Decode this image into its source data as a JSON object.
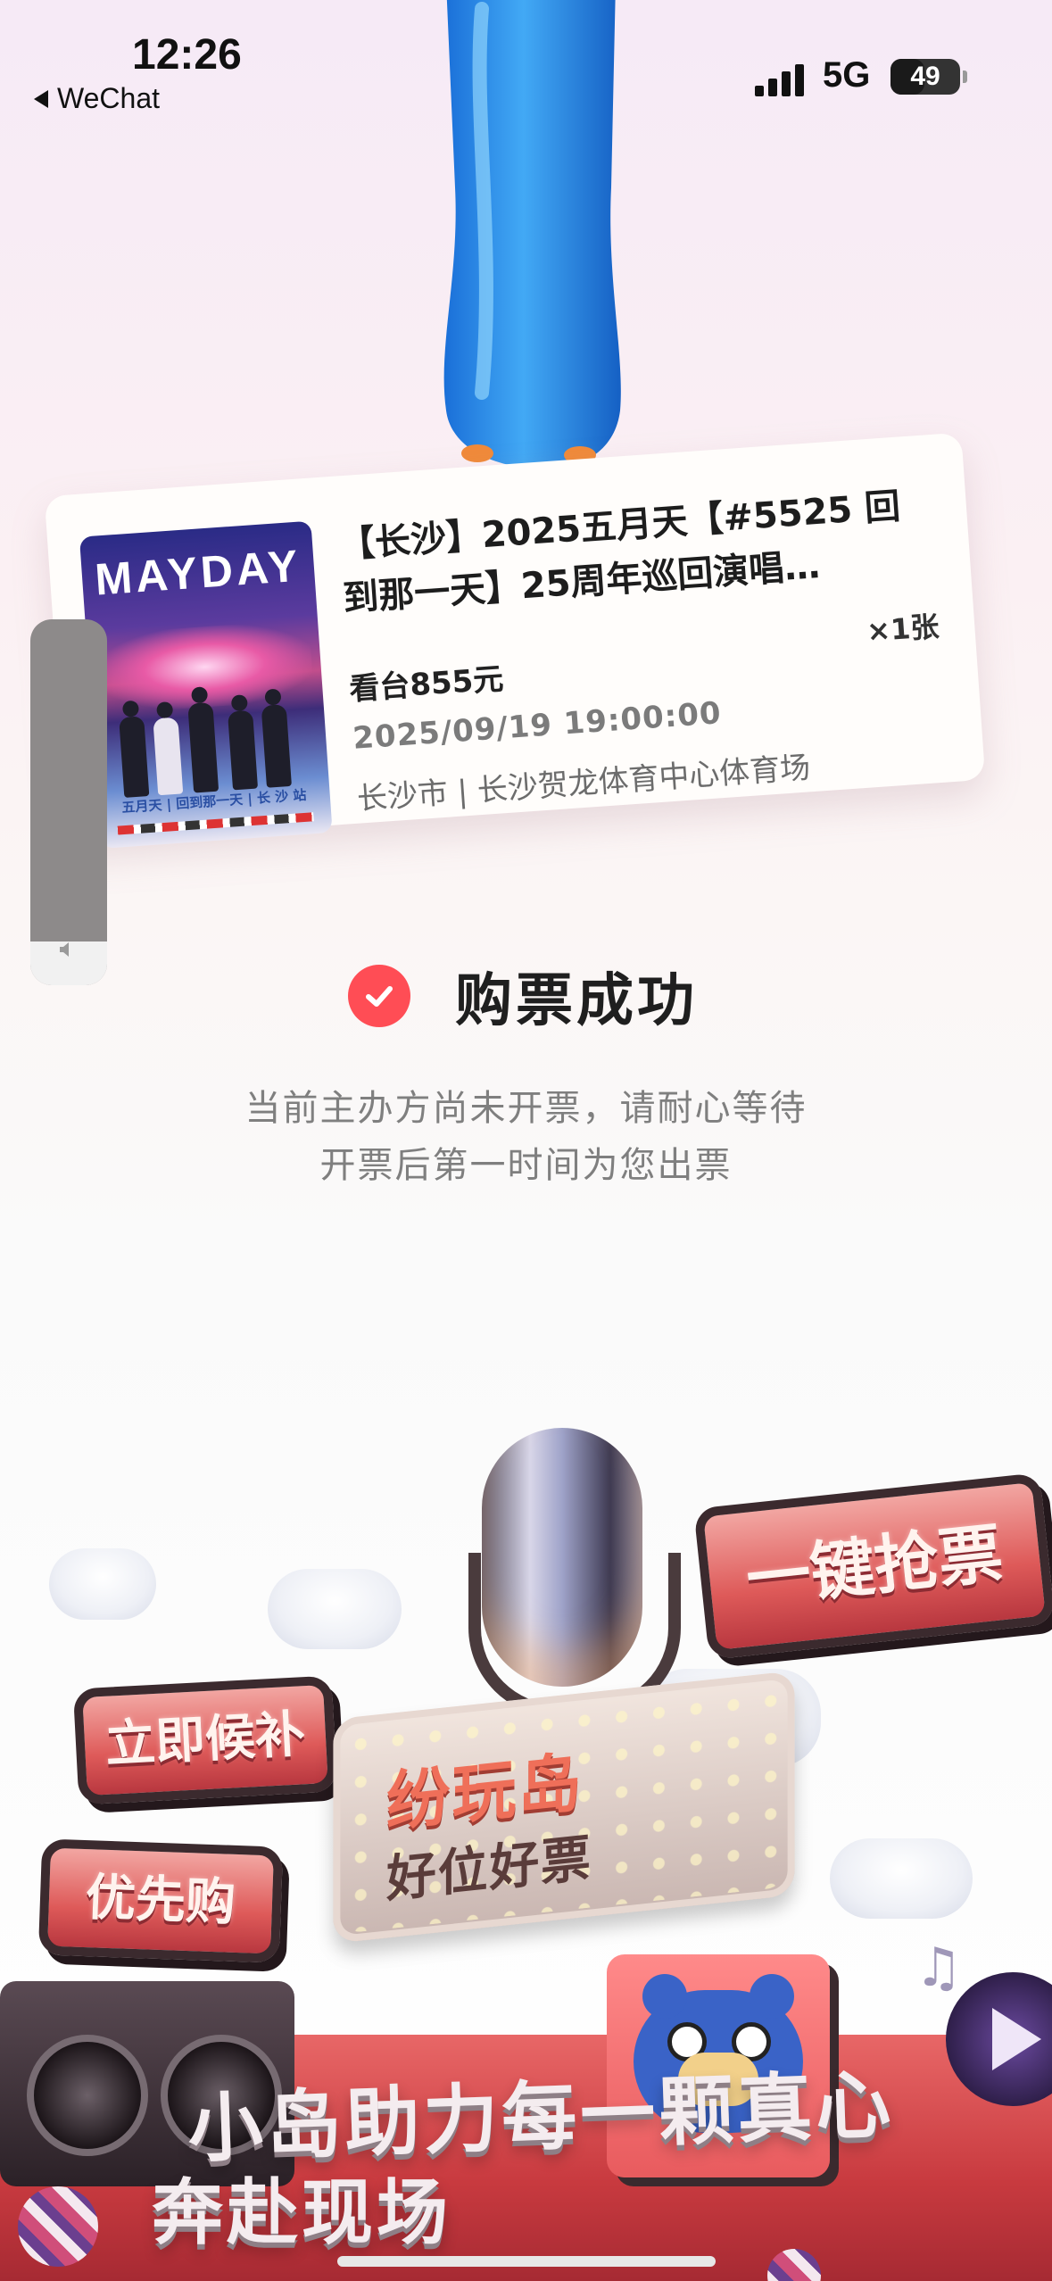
{
  "status_bar": {
    "time": "12:26",
    "back_app": "WeChat",
    "network": "5G",
    "battery": "49",
    "battery_level": 0.49
  },
  "ticket": {
    "title": "【长沙】2025五月天【#5525 回到那一天】25周年巡回演唱…",
    "poster_title": "MAYDAY",
    "poster_footer": "五月天 | 回到那一天 | 长 沙 站",
    "quantity": "×1张",
    "seat": "看台855元",
    "datetime": "2025/09/19 19:00:00",
    "venue": "长沙市 | 长沙贺龙体育中心体育场"
  },
  "volume": {
    "level": 0.12,
    "icon": "speaker-icon"
  },
  "result": {
    "title": "购票成功",
    "icon": "check-circle-icon",
    "notice_line1": "当前主办方尚未开票，请耐心等待",
    "notice_line2": "开票后第一时间为您出票"
  },
  "promo": {
    "sign_right": "一键抢票",
    "sign_left_top": "立即候补",
    "sign_left_bottom": "优先购",
    "marquee_title": "纷玩岛",
    "marquee_sub": "好位好票",
    "slogan_line1": "小岛助力每一颗真心",
    "slogan_line2": "奔赴现场"
  },
  "colors": {
    "accent": "#ff4d55",
    "sign_red": "#de5a59"
  }
}
